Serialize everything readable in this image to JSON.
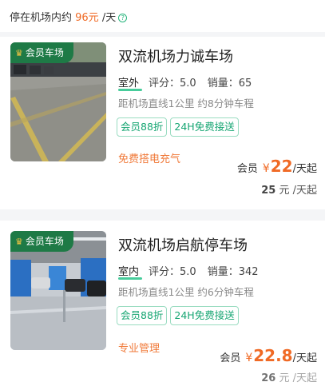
{
  "notice": {
    "prefix": "停在机场内约 ",
    "price": "96元",
    "suffix": " /天",
    "help_icon": "?"
  },
  "lots": [
    {
      "badge": "会员车场",
      "name": "双流机场力诚车场",
      "type": "室外",
      "rating_label": "评分：",
      "rating": "5.0",
      "sales_label": "销量：",
      "sales": "65",
      "distance": "距机场直线1公里 约8分钟车程",
      "tags": [
        "会员88折",
        "24H免费接送"
      ],
      "service": "免费搭电充气",
      "member_label": "会员",
      "currency": "¥",
      "member_price": "22",
      "unit": "/天起",
      "normal_price": "25",
      "normal_unit": " 元 /天起"
    },
    {
      "badge": "会员车场",
      "name": "双流机场启航停车场",
      "type": "室内",
      "rating_label": "评分：",
      "rating": "5.0",
      "sales_label": "销量：",
      "sales": "342",
      "distance": "距机场直线1公里 约6分钟车程",
      "tags": [
        "会员88折",
        "24H免费接送"
      ],
      "service": "专业管理",
      "member_label": "会员",
      "currency": "¥",
      "member_price": "22.8",
      "unit": "/天起",
      "normal_price": "26",
      "normal_unit": " 元 /天起"
    }
  ],
  "colors": {
    "accent": "#f06a25",
    "green": "#17a673",
    "badge": "#1e7a46"
  }
}
